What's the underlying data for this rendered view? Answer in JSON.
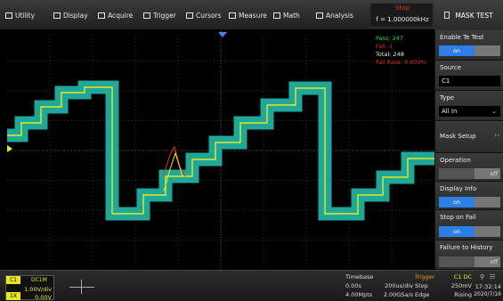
{
  "menu": {
    "items": [
      {
        "label": "Utility",
        "icon": "utility-icon"
      },
      {
        "label": "Display",
        "icon": "display-icon"
      },
      {
        "label": "Acquire",
        "icon": "acquire-icon"
      },
      {
        "label": "Trigger",
        "icon": "trigger-icon"
      },
      {
        "label": "Cursors",
        "icon": "cursors-icon"
      },
      {
        "label": "Measure",
        "icon": "measure-icon"
      },
      {
        "label": "Math",
        "icon": "math-icon"
      },
      {
        "label": "Analysis",
        "icon": "analysis-icon"
      }
    ],
    "run_state": "Stop",
    "frequency": "f = 1.000000kHz",
    "panel_title": "MASK TEST"
  },
  "stats": {
    "pass": "Pass: 247",
    "fail": "Fail: 1",
    "total": "Total: 248",
    "fail_rate": "Fail Rate: 0.403%"
  },
  "panel": {
    "enable_label": "Enable Te Test",
    "enable_state": "on",
    "source_label": "Source",
    "source_value": "C1",
    "type_label": "Type",
    "type_value": "All In",
    "mask_setup_label": "Mask Setup",
    "operation_label": "Operation",
    "operation_state": "off",
    "display_info_label": "Display Info",
    "display_info_state": "on",
    "stop_on_fail_label": "Stop on Fail",
    "stop_on_fail_state": "on",
    "failure_history_label": "Failure to History",
    "failure_history_state": "off"
  },
  "bottom": {
    "channel": "C1",
    "coupling": "DC1M",
    "vdiv": "1.00V/div",
    "offset": "0.00V",
    "channel_short": "1X",
    "timebase_label": "Timebase",
    "tb_delay": "0.00s",
    "tb_scale": "200us/div",
    "tb_pts": "4.00Mpts",
    "tb_rate": "2.00GSa/s",
    "trigger_label": "Trigger",
    "trigger_src": "C1 DC",
    "trigger_mode": "Stop",
    "trigger_level": "250mV",
    "trigger_type": "Edge",
    "trigger_slope": "Rising",
    "time": "17:32:14",
    "date": "2020/7/16"
  },
  "colors": {
    "waveform": "#e8e821",
    "mask": "#1fa89a",
    "accent": "#2d7fe8",
    "stop": "#e03030",
    "pass": "#22dd22",
    "fail": "#e03030",
    "marker": "#2d7fe8"
  }
}
